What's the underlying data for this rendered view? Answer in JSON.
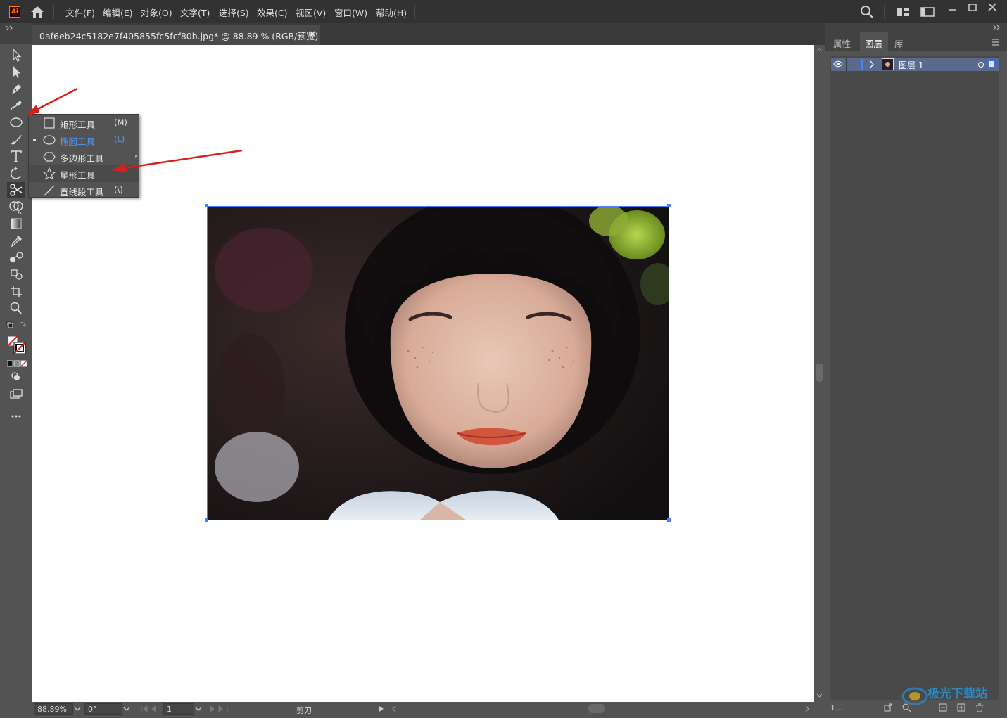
{
  "app": {
    "logo_text": "Ai"
  },
  "menu": [
    "文件(F)",
    "编辑(E)",
    "对象(O)",
    "文字(T)",
    "选择(S)",
    "效果(C)",
    "视图(V)",
    "窗口(W)",
    "帮助(H)"
  ],
  "document_tab": {
    "title": "0af6eb24c5182e7f405855fc5fcf80b.jpg* @ 88.89 % (RGB/预览)",
    "close": "×"
  },
  "flyout": {
    "items": [
      {
        "label": "矩形工具",
        "shortcut": "(M)"
      },
      {
        "label": "椭圆工具",
        "shortcut": "(L)",
        "selected": true
      },
      {
        "label": "多边形工具",
        "shortcut": ""
      },
      {
        "label": "星形工具",
        "shortcut": ""
      },
      {
        "label": "直线段工具",
        "shortcut": "(\\)"
      }
    ]
  },
  "status": {
    "zoom": "88.89%",
    "rotation": "0°",
    "artboard": "1",
    "tool": "剪刀"
  },
  "panel": {
    "tabs": [
      "属性",
      "图层",
      "库"
    ],
    "active_tab": "图层",
    "layers": [
      {
        "name": "图层 1"
      }
    ],
    "footer_count": "1..."
  },
  "colors": {
    "accent": "#4a7dff",
    "arrow": "#d7201a",
    "selected_text": "#4d9cff"
  },
  "watermark": {
    "text": "极光下载站"
  }
}
